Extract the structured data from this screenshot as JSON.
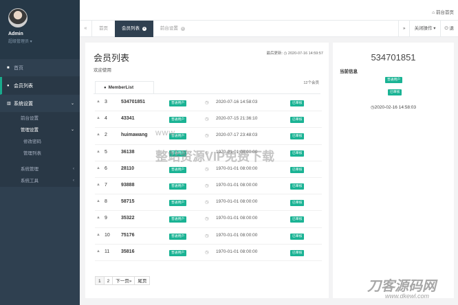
{
  "sidebar": {
    "admin_name": "Admin",
    "admin_role": "超级管理员 ▾",
    "menu": {
      "home": "首页",
      "members": "会员列表",
      "system_settings": "系统设置",
      "frontend_settings": "前台设置",
      "admin_settings": "管理设置",
      "change_password": "修改密码",
      "admin_list": "管理列表",
      "system_admin": "系统管理",
      "system_tools": "系统工具"
    }
  },
  "topbar": {
    "home_link": "前台首页"
  },
  "tabs": {
    "items": [
      "首页",
      "会员列表",
      "前台设置"
    ],
    "close_action": "关闭操作",
    "logout": "退"
  },
  "main": {
    "title": "会员列表",
    "welcome": "欢迎使用",
    "last_update_label": "最后更新:",
    "last_update": "2020-07-16 14:59:57",
    "list_tab": "MemberList",
    "member_count": "12个会员",
    "rows": [
      {
        "rank": "3",
        "username": "534701851",
        "badge": "普通用户",
        "time": "2020-07-16 14:58:03",
        "status": "已审核"
      },
      {
        "rank": "4",
        "username": "43341",
        "badge": "普通用户",
        "time": "2020-07-15 21:36:10",
        "status": "已审核"
      },
      {
        "rank": "2",
        "username": "huimawang",
        "badge": "普通用户",
        "time": "2020-07-17 23:48:03",
        "status": "已审核"
      },
      {
        "rank": "5",
        "username": "36138",
        "badge": "普通用户",
        "time": "1970-01-01 08:00:00",
        "status": "已审核"
      },
      {
        "rank": "6",
        "username": "28110",
        "badge": "普通用户",
        "time": "1970-01-01 08:00:00",
        "status": "已审核"
      },
      {
        "rank": "7",
        "username": "93888",
        "badge": "普通用户",
        "time": "1970-01-01 08:00:00",
        "status": "已审核"
      },
      {
        "rank": "8",
        "username": "58715",
        "badge": "普通用户",
        "time": "1970-01-01 08:00:00",
        "status": "已审核"
      },
      {
        "rank": "9",
        "username": "35322",
        "badge": "普通用户",
        "time": "1970-01-01 08:00:00",
        "status": "已审核"
      },
      {
        "rank": "10",
        "username": "75176",
        "badge": "普通用户",
        "time": "1970-01-01 08:00:00",
        "status": "已审核"
      },
      {
        "rank": "11",
        "username": "35816",
        "badge": "普通用户",
        "time": "1970-01-01 08:00:00",
        "status": "已审核"
      }
    ],
    "pager": [
      "1",
      "2",
      "下一页»",
      "尾页"
    ]
  },
  "side": {
    "uid": "534701851",
    "current_info": "当前信息",
    "badge": "普通用户",
    "status": "已审核",
    "time": "2020-02-16 14:58:03"
  },
  "watermark": {
    "line1": "www.",
    "line2": "整站资源VIP免费下载",
    "brand": "刀客源码网",
    "brand_url": "www.dkewl.com"
  },
  "colors": {
    "sidebar": "#2f4050",
    "accent": "#1ab394"
  }
}
